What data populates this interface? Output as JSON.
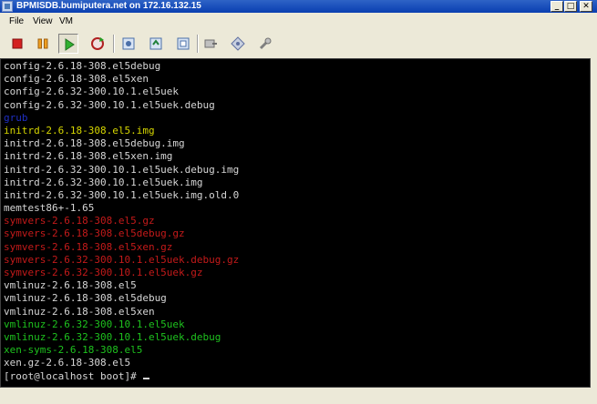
{
  "window": {
    "title": "BPMISDB.bumiputera.net on 172.16.132.15",
    "minimize_label": "_",
    "maximize_label": "□",
    "close_label": "✕"
  },
  "menu": {
    "items": [
      "File",
      "View",
      "VM"
    ]
  },
  "toolbar": {
    "buttons": [
      {
        "name": "power-off",
        "icon": "stop-square-red"
      },
      {
        "name": "suspend",
        "icon": "pause-bars-orange"
      },
      {
        "name": "power-on",
        "icon": "play-triangle-green"
      },
      {
        "name": "reset",
        "icon": "refresh-arrows"
      },
      {
        "name": "snapshot",
        "icon": "snapshot-icon"
      },
      {
        "name": "revert-snapshot",
        "icon": "revert-icon"
      },
      {
        "name": "snapshot-manager",
        "icon": "snapshot-manager-icon"
      },
      {
        "name": "connect-devices",
        "icon": "device-icon"
      },
      {
        "name": "settings",
        "icon": "settings-icon"
      },
      {
        "name": "wrench",
        "icon": "wrench-icon"
      }
    ]
  },
  "colors": {
    "default": "#d6d6d6",
    "blue": "#1f2fc4",
    "yellow": "#d6d600",
    "red": "#c41a1a",
    "green": "#1ec21e"
  },
  "console": {
    "lines": [
      {
        "text": "config-2.6.18-308.el5debug",
        "color": "default"
      },
      {
        "text": "config-2.6.18-308.el5xen",
        "color": "default"
      },
      {
        "text": "config-2.6.32-300.10.1.el5uek",
        "color": "default"
      },
      {
        "text": "config-2.6.32-300.10.1.el5uek.debug",
        "color": "default"
      },
      {
        "text": "grub",
        "color": "blue"
      },
      {
        "text": "initrd-2.6.18-308.el5.img",
        "color": "yellow"
      },
      {
        "text": "initrd-2.6.18-308.el5debug.img",
        "color": "default"
      },
      {
        "text": "initrd-2.6.18-308.el5xen.img",
        "color": "default"
      },
      {
        "text": "initrd-2.6.32-300.10.1.el5uek.debug.img",
        "color": "default"
      },
      {
        "text": "initrd-2.6.32-300.10.1.el5uek.img",
        "color": "default"
      },
      {
        "text": "initrd-2.6.32-300.10.1.el5uek.img.old.0",
        "color": "default"
      },
      {
        "text": "memtest86+-1.65",
        "color": "default"
      },
      {
        "text": "symvers-2.6.18-308.el5.gz",
        "color": "red"
      },
      {
        "text": "symvers-2.6.18-308.el5debug.gz",
        "color": "red"
      },
      {
        "text": "symvers-2.6.18-308.el5xen.gz",
        "color": "red"
      },
      {
        "text": "symvers-2.6.32-300.10.1.el5uek.debug.gz",
        "color": "red"
      },
      {
        "text": "symvers-2.6.32-300.10.1.el5uek.gz",
        "color": "red"
      },
      {
        "text": "vmlinuz-2.6.18-308.el5",
        "color": "default"
      },
      {
        "text": "vmlinuz-2.6.18-308.el5debug",
        "color": "default"
      },
      {
        "text": "vmlinuz-2.6.18-308.el5xen",
        "color": "default"
      },
      {
        "text": "vmlinuz-2.6.32-300.10.1.el5uek",
        "color": "green"
      },
      {
        "text": "vmlinuz-2.6.32-300.10.1.el5uek.debug",
        "color": "green"
      },
      {
        "text": "xen-syms-2.6.18-308.el5",
        "color": "green"
      },
      {
        "text": "xen.gz-2.6.18-308.el5",
        "color": "default"
      }
    ],
    "prompt": "[root@localhost boot]# "
  }
}
